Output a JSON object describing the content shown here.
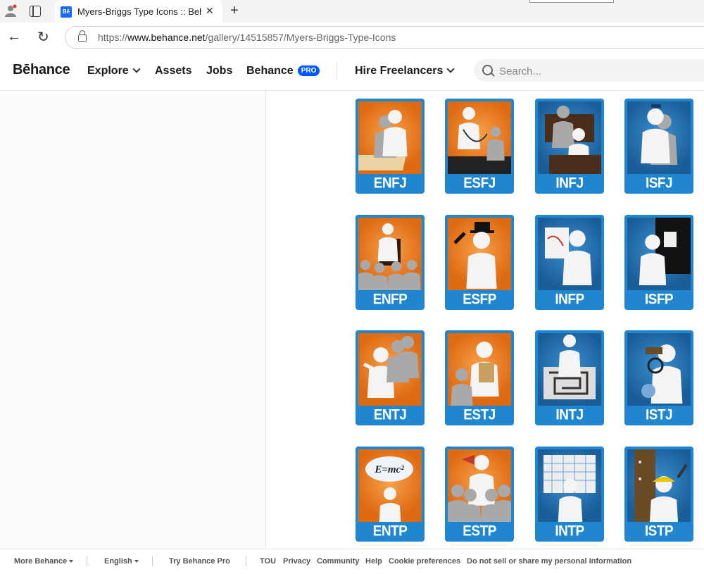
{
  "browser": {
    "tab_title": "Myers-Briggs Type Icons :: Behance",
    "tab_favicon": "Bē",
    "url_prefix": "https://",
    "url_host": "www.behance.net",
    "url_path": "/gallery/14515857/Myers-Briggs-Type-Icons"
  },
  "nav": {
    "logo": "Bēhance",
    "explore": "Explore",
    "assets": "Assets",
    "jobs": "Jobs",
    "behance": "Behance",
    "pro_badge": "PRO",
    "hire": "Hire Freelancers",
    "search_placeholder": "Search..."
  },
  "colors": {
    "brand_blue": "#0057ff",
    "card_blue": "#1f86cf",
    "card_orange": "#de6a12"
  },
  "gallery": {
    "cards": [
      {
        "label": "ENFJ",
        "bg": "orange",
        "icon": "person-writing-icon"
      },
      {
        "label": "ESFJ",
        "bg": "orange",
        "icon": "doctor-stethoscope-icon"
      },
      {
        "label": "INFJ",
        "bg": "blue",
        "icon": "counselor-icon"
      },
      {
        "label": "ISFJ",
        "bg": "blue",
        "icon": "police-officer-icon"
      },
      {
        "label": "ENFP",
        "bg": "orange",
        "icon": "speaker-crowd-icon"
      },
      {
        "label": "ESFP",
        "bg": "orange",
        "icon": "magician-top-hat-icon"
      },
      {
        "label": "INFP",
        "bg": "blue",
        "icon": "painter-easel-icon"
      },
      {
        "label": "ISFP",
        "bg": "blue",
        "icon": "pianist-icon"
      },
      {
        "label": "ENTJ",
        "bg": "orange",
        "icon": "leader-pointing-icon"
      },
      {
        "label": "ESTJ",
        "bg": "orange",
        "icon": "manager-clipboard-icon"
      },
      {
        "label": "INTJ",
        "bg": "blue",
        "icon": "maze-solver-icon"
      },
      {
        "label": "ISTJ",
        "bg": "blue",
        "icon": "detective-magnifier-icon"
      },
      {
        "label": "ENTP",
        "bg": "orange",
        "icon": "thinker-emc2-icon"
      },
      {
        "label": "ESTP",
        "bg": "orange",
        "icon": "megaphone-crowd-icon"
      },
      {
        "label": "INTP",
        "bg": "blue",
        "icon": "architect-blueprint-icon"
      },
      {
        "label": "ISTP",
        "bg": "blue",
        "icon": "builder-hammer-icon"
      }
    ],
    "thought_bubble": "E=mc²"
  },
  "footer": {
    "more_behance": "More Behance",
    "english": "English",
    "try_pro": "Try Behance Pro",
    "tou": "TOU",
    "privacy": "Privacy",
    "community": "Community",
    "help": "Help",
    "cookies": "Cookie preferences",
    "do_not_sell": "Do not sell or share my personal information"
  }
}
